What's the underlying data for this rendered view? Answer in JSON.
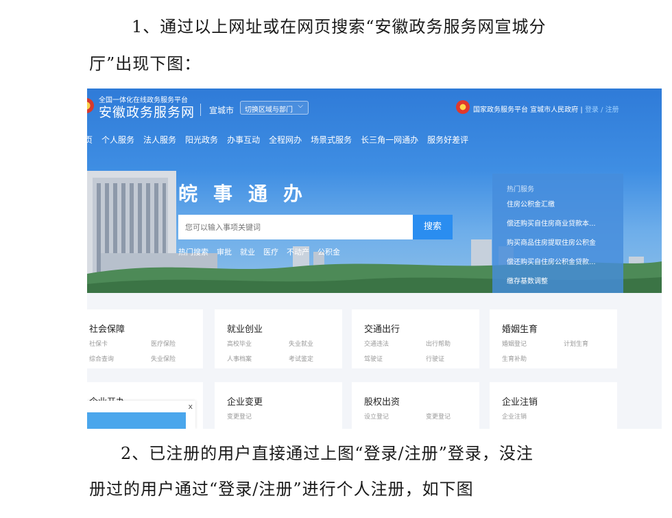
{
  "paragraphs": {
    "p1_line1": "1、通过以上网址或在网页搜索“安徽政务服务网宣城分",
    "p1_line2": "厅”出现下图：",
    "p2_line1": "2、已注册的用户直接通过上图“登录/注册”登录，没注",
    "p2_line2": "册过的用户通过“登录/注册”进行个人注册，如下图"
  },
  "site": {
    "subtitle": "全国一体化在线政务服务平台",
    "name": "安徽政务服务网",
    "city": "宣城市",
    "region_select": "切换区域与部门",
    "top_right_text": "国家政务服务平台 宣城市人民政府",
    "login": "登录",
    "slash": "/",
    "register": "注册"
  },
  "nav": [
    "页",
    "个人服务",
    "法人服务",
    "阳光政务",
    "办事互动",
    "全程网办",
    "场景式服务",
    "长三角一网通办",
    "服务好差评"
  ],
  "hero": {
    "slogan": [
      "皖",
      "事",
      "通",
      "办"
    ],
    "search_placeholder": "您可以输入事项关键词",
    "search_button": "搜索",
    "hot_search": [
      "热门搜索",
      "审批",
      "就业",
      "医疗",
      "不动产",
      "公积金"
    ]
  },
  "hot_services": {
    "title": "热门服务",
    "items": [
      "住房公积金汇缴",
      "偿还购买自住房商业贷款本...",
      "购买商品住房提取住房公积金",
      "偿还购买自住房公积金贷款...",
      "缴存基数调整"
    ]
  },
  "categories": [
    {
      "title": "社会保障",
      "links": [
        "社保卡",
        "医疗保险",
        "综合查询",
        "失业保险"
      ]
    },
    {
      "title": "就业创业",
      "links": [
        "高校毕业",
        "失业就业",
        "人事档案",
        "考试鉴定"
      ]
    },
    {
      "title": "交通出行",
      "links": [
        "交通违法",
        "出行帮助",
        "驾驶证",
        "行驶证"
      ]
    },
    {
      "title": "婚姻生育",
      "links": [
        "婚姻登记",
        "计划生育",
        "生育补助",
        ""
      ]
    },
    {
      "title": "企业开办",
      "links": [
        "",
        "",
        "",
        ""
      ]
    },
    {
      "title": "企业变更",
      "links": [
        "变更登记",
        "",
        "",
        ""
      ]
    },
    {
      "title": "股权出资",
      "links": [
        "设立登记",
        "变更登记",
        "",
        ""
      ]
    },
    {
      "title": "企业注销",
      "links": [
        "企业注销",
        "",
        "",
        ""
      ]
    }
  ],
  "popup": {
    "close": "x"
  },
  "colors": {
    "hero_top": "#2f7bd8",
    "search_button": "#2a8df0",
    "hot_panel": "#468cdc",
    "link_blue": "#9fd1ff"
  }
}
